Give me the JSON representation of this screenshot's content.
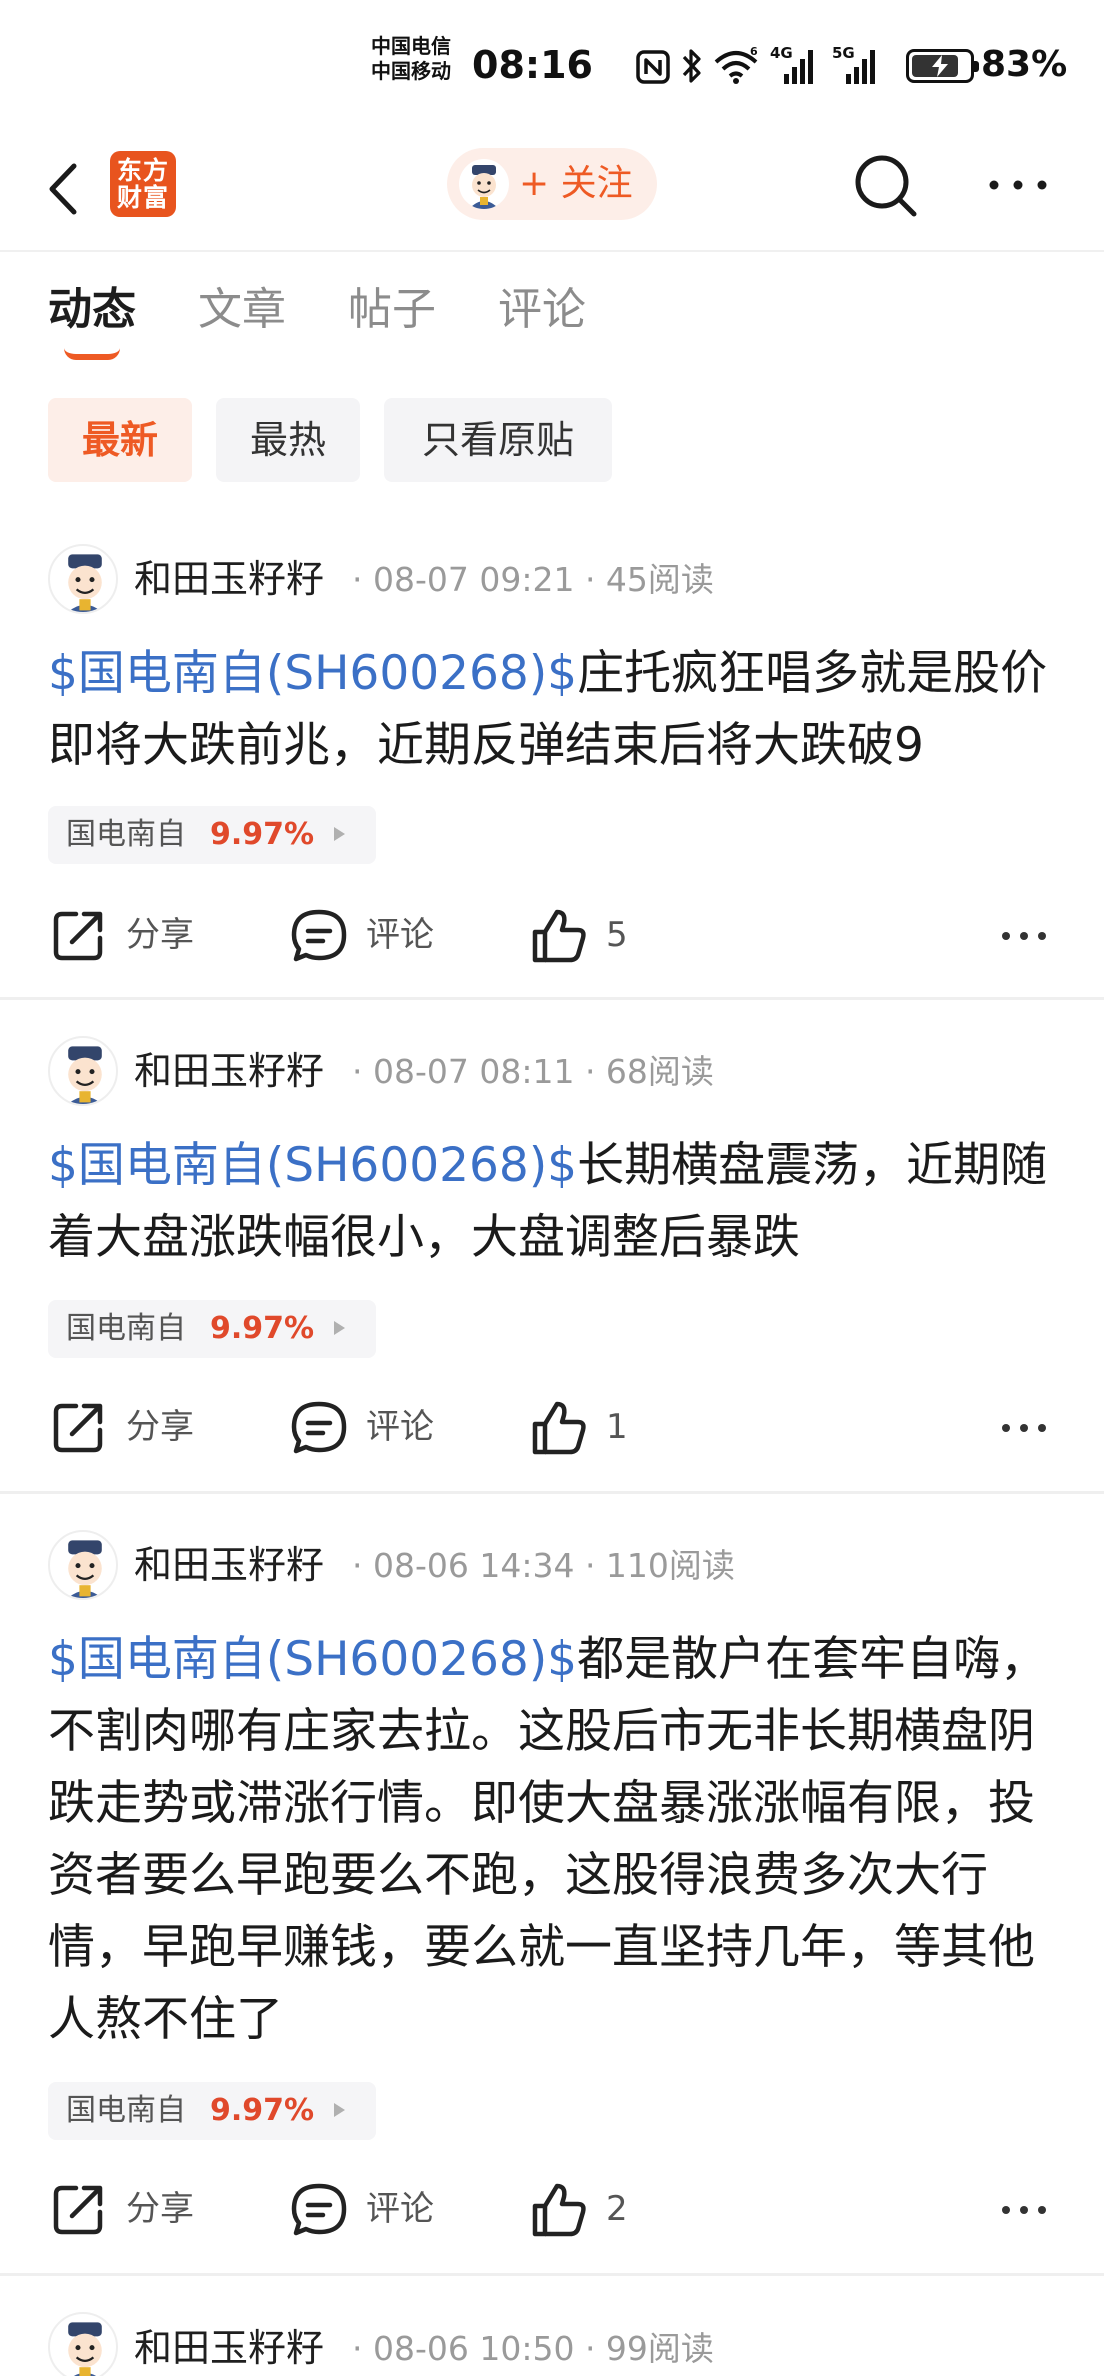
{
  "status_bar": {
    "carrier_1": "中国电信",
    "carrier_2": "中国移动",
    "time": "08:16",
    "network_1": "4G",
    "network_2": "5G",
    "battery_level": 0.83,
    "battery_pct": "83%"
  },
  "nav": {
    "logo_line1": "东方",
    "logo_line2": "财富",
    "follow_label": "+ 关注"
  },
  "tabs": [
    {
      "label": "动态",
      "active": true
    },
    {
      "label": "文章",
      "active": false
    },
    {
      "label": "帖子",
      "active": false
    },
    {
      "label": "评论",
      "active": false
    }
  ],
  "filters": [
    {
      "label": "最新",
      "active": true
    },
    {
      "label": "最热",
      "active": false
    },
    {
      "label": "只看原贴",
      "active": false
    }
  ],
  "actions": {
    "share": "分享",
    "comment": "评论"
  },
  "colors": {
    "accent": "#ee5a24",
    "link": "#3b70c6",
    "up": "#e0492b"
  },
  "posts": [
    {
      "author": "和田玉籽籽",
      "meta": "· 08-07 09:21 · 45阅读",
      "stock_link": "$国电南自(SH600268)$",
      "text": "庄托疯狂唱多就是股价即将大跌前兆，近期反弹结束后将大跌破9",
      "tag_name": "国电南自",
      "tag_pct": "9.97%",
      "likes": "5"
    },
    {
      "author": "和田玉籽籽",
      "meta": "· 08-07 08:11 · 68阅读",
      "stock_link": "$国电南自(SH600268)$",
      "text": "长期横盘震荡，近期随着大盘涨跌幅很小，大盘调整后暴跌",
      "tag_name": "国电南自",
      "tag_pct": "9.97%",
      "likes": "1"
    },
    {
      "author": "和田玉籽籽",
      "meta": "· 08-06 14:34 · 110阅读",
      "stock_link": "$国电南自(SH600268)$",
      "text": "都是散户在套牢自嗨，不割肉哪有庄家去拉。这股后市无非长期横盘阴跌走势或滞涨行情。即使大盘暴涨涨幅有限，投资者要么早跑要么不跑，这股得浪费多次大行情，早跑早赚钱，要么就一直坚持几年，等其他人熬不住了",
      "tag_name": "国电南自",
      "tag_pct": "9.97%",
      "likes": "2"
    },
    {
      "author": "和田玉籽籽",
      "meta": "· 08-06 10:50 · 99阅读"
    }
  ]
}
